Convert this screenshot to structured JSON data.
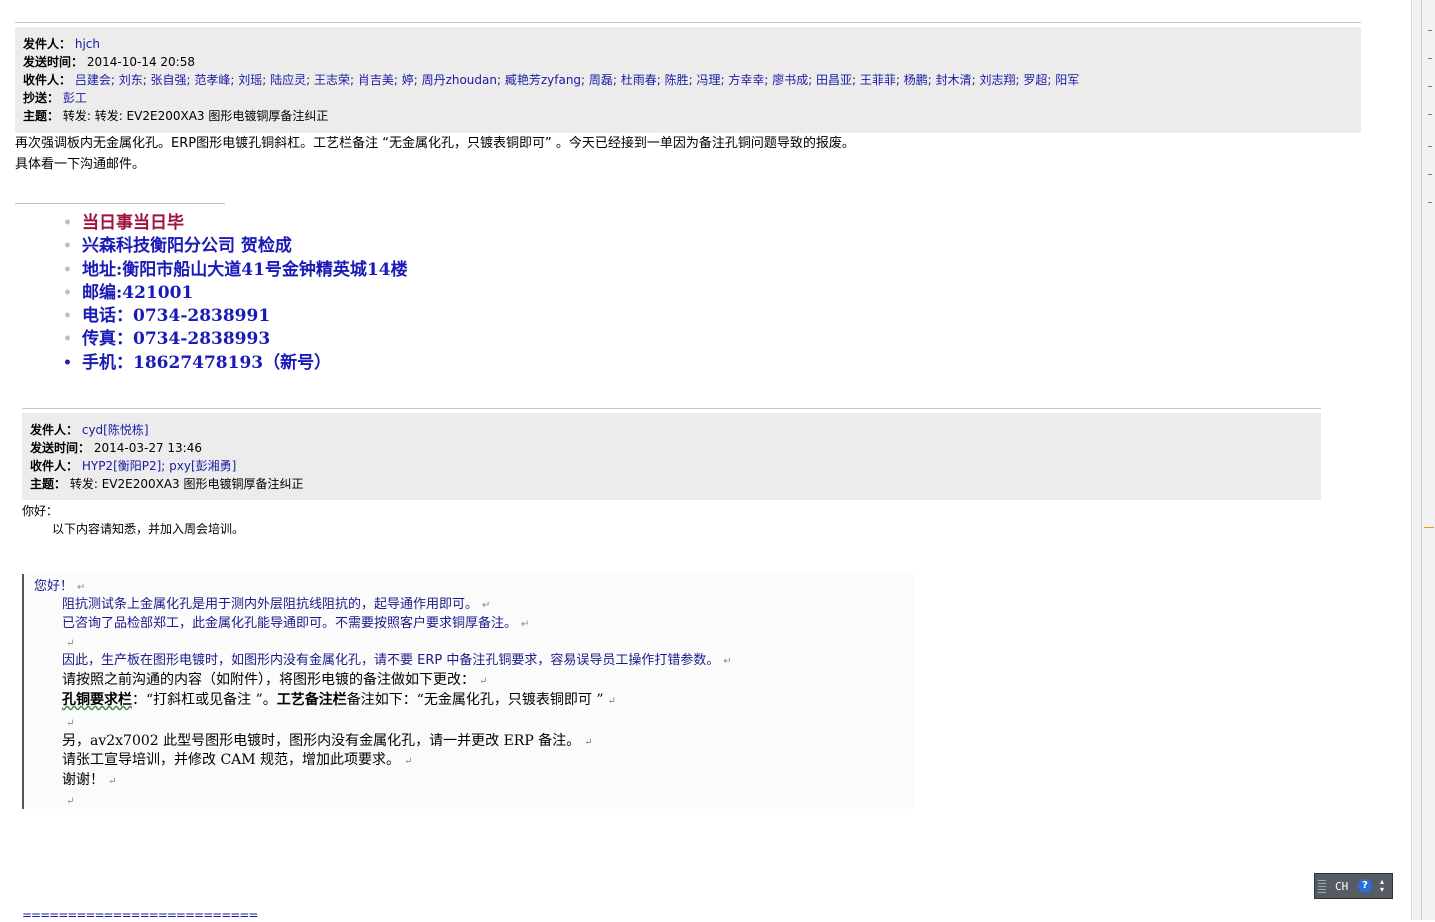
{
  "email1": {
    "from_label": "发件人：",
    "from": "hjch",
    "sent_label": "发送时间：",
    "sent": "2014-10-14 20:58",
    "to_label": "收件人：",
    "to": "吕建会; 刘东; 张自强; 范孝峰; 刘瑶; 陆应灵; 王志荣; 肖吉美; 婷; 周丹zhoudan; 臧艳芳zyfang; 周磊; 杜雨春; 陈胜; 冯理; 方幸幸; 廖书成; 田昌亚; 王菲菲; 杨鹏; 封木清; 刘志翔; 罗超; 阳军",
    "cc_label": "抄送：",
    "cc": "彭工",
    "subject_label": "主题：",
    "subject": "转发: 转发: EV2E200XA3 图形电镀铜厚备注纠正",
    "body_line1": "再次强调板内无金属化孔。ERP图形电镀孔铜斜杠。工艺栏备注 “无金属化孔，只镀表铜即可” 。今天已经接到一单因为备注孔铜问题导致的报废。",
    "body_line2": "具体看一下沟通邮件。"
  },
  "signature": {
    "motto": "当日事当日毕",
    "company": " 兴森科技衡阳分公司   贺检成",
    "address": "地址:衡阳市船山大道41号金钟精英城14楼",
    "postcode": "邮编:421001",
    "phone": "电话：0734-2838991",
    "fax": "传真：0734-2838993",
    "mobile": "手机：18627478193（新号）"
  },
  "email2": {
    "from_label": "发件人：",
    "from": "cyd[陈悦栋]",
    "sent_label": "发送时间：",
    "sent": "2014-03-27 13:46",
    "to_label": "收件人：",
    "to": "HYP2[衡阳P2]; pxy[彭湘勇]",
    "subject_label": "主题：",
    "subject": "转发: EV2E200XA3 图形电镀铜厚备注纠正",
    "greeting": "你好：",
    "body": "以下内容请知悉，并加入周会培训。"
  },
  "quoted": {
    "greeting": "您好！",
    "line1": "阻抗测试条上金属化孔是用于测内外层阻抗线阻抗的，起导通作用即可。",
    "line2": "已咨询了品检部郑工，此金属化孔能导通即可。不需要按照客户要求铜厚备注。",
    "line3": "因此，生产板在图形电镀时，如图形内没有金属化孔，请不要 ERP 中备注孔铜要求，容易误导员工操作打错参数。",
    "line4": "请按照之前沟通的内容（如附件），将图形电镀的备注做如下更改：",
    "line5_a": "孔铜要求栏",
    "line5_b": "：“打斜杠或见备注 ”。",
    "line5_c": "工艺备注栏",
    "line5_d": "备注如下：“无金属化孔，只镀表铜即可 ”",
    "line6": "另，av2x7002 此型号图形电镀时，图形内没有金属化孔，请一并更改 ERP 备注。",
    "line7": "请张工宣导培训，并修改 CAM 规范，增加此项要求。",
    "line8": "谢谢！",
    "para_mark": "↵"
  },
  "footer_rule": "==========================",
  "language_bar": {
    "lang": "CH",
    "help": "?"
  }
}
